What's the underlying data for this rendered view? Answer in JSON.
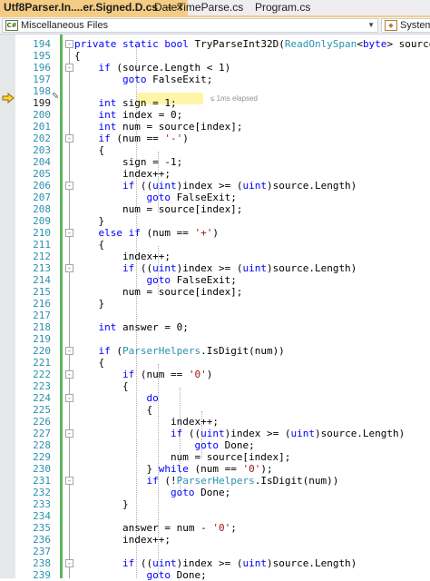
{
  "tabs": [
    {
      "label": "Utf8Parser.In....er.Signed.D.cs",
      "pin": "⊣",
      "close": "✕"
    },
    {
      "label": "DateTimeParse.cs"
    },
    {
      "label": "Program.cs"
    }
  ],
  "navbar": {
    "left": "Miscellaneous Files",
    "right": "System"
  },
  "elapsed": "≤ 1ms elapsed",
  "lines": [
    {
      "n": "194",
      "fold": "-",
      "tokens": [
        [
          "k",
          "private"
        ],
        [
          "p",
          " "
        ],
        [
          "k",
          "static"
        ],
        [
          "p",
          " "
        ],
        [
          "k",
          "bool"
        ],
        [
          "p",
          " TryParseInt32D("
        ],
        [
          "t",
          "ReadOnlySpan"
        ],
        [
          "p",
          "<"
        ],
        [
          "k",
          "byte"
        ],
        [
          "p",
          "> source, "
        ]
      ]
    },
    {
      "n": "195",
      "tokens": [
        [
          "p",
          "{"
        ]
      ]
    },
    {
      "n": "196",
      "fold": "-",
      "tokens": [
        [
          "p",
          "    "
        ],
        [
          "k",
          "if"
        ],
        [
          "p",
          " (source.Length < 1)"
        ]
      ]
    },
    {
      "n": "197",
      "tokens": [
        [
          "p",
          "        "
        ],
        [
          "k",
          "goto"
        ],
        [
          "p",
          " FalseExit;"
        ]
      ]
    },
    {
      "n": "198",
      "tokens": []
    },
    {
      "n": "199",
      "current": true,
      "tokens": [
        [
          "p",
          "    "
        ],
        [
          "k",
          "int"
        ],
        [
          "p",
          " sign = 1;"
        ]
      ]
    },
    {
      "n": "200",
      "tokens": [
        [
          "p",
          "    "
        ],
        [
          "k",
          "int"
        ],
        [
          "p",
          " index = 0;"
        ]
      ]
    },
    {
      "n": "201",
      "tokens": [
        [
          "p",
          "    "
        ],
        [
          "k",
          "int"
        ],
        [
          "p",
          " num = source[index];"
        ]
      ]
    },
    {
      "n": "202",
      "fold": "-",
      "tokens": [
        [
          "p",
          "    "
        ],
        [
          "k",
          "if"
        ],
        [
          "p",
          " (num == "
        ],
        [
          "s",
          "'-'"
        ],
        [
          "p",
          ")"
        ]
      ]
    },
    {
      "n": "203",
      "tokens": [
        [
          "p",
          "    {"
        ]
      ]
    },
    {
      "n": "204",
      "tokens": [
        [
          "p",
          "        sign = -1;"
        ]
      ]
    },
    {
      "n": "205",
      "tokens": [
        [
          "p",
          "        index++;"
        ]
      ]
    },
    {
      "n": "206",
      "fold": "-",
      "tokens": [
        [
          "p",
          "        "
        ],
        [
          "k",
          "if"
        ],
        [
          "p",
          " (("
        ],
        [
          "k",
          "uint"
        ],
        [
          "p",
          ")index >= ("
        ],
        [
          "k",
          "uint"
        ],
        [
          "p",
          ")source.Length)"
        ]
      ]
    },
    {
      "n": "207",
      "tokens": [
        [
          "p",
          "            "
        ],
        [
          "k",
          "goto"
        ],
        [
          "p",
          " FalseExit;"
        ]
      ]
    },
    {
      "n": "208",
      "tokens": [
        [
          "p",
          "        num = source[index];"
        ]
      ]
    },
    {
      "n": "209",
      "tokens": [
        [
          "p",
          "    }"
        ]
      ]
    },
    {
      "n": "210",
      "fold": "-",
      "tokens": [
        [
          "p",
          "    "
        ],
        [
          "k",
          "else"
        ],
        [
          "p",
          " "
        ],
        [
          "k",
          "if"
        ],
        [
          "p",
          " (num == "
        ],
        [
          "s",
          "'+'"
        ],
        [
          "p",
          ")"
        ]
      ]
    },
    {
      "n": "211",
      "tokens": [
        [
          "p",
          "    {"
        ]
      ]
    },
    {
      "n": "212",
      "tokens": [
        [
          "p",
          "        index++;"
        ]
      ]
    },
    {
      "n": "213",
      "fold": "-",
      "tokens": [
        [
          "p",
          "        "
        ],
        [
          "k",
          "if"
        ],
        [
          "p",
          " (("
        ],
        [
          "k",
          "uint"
        ],
        [
          "p",
          ")index >= ("
        ],
        [
          "k",
          "uint"
        ],
        [
          "p",
          ")source.Length)"
        ]
      ]
    },
    {
      "n": "214",
      "tokens": [
        [
          "p",
          "            "
        ],
        [
          "k",
          "goto"
        ],
        [
          "p",
          " FalseExit;"
        ]
      ]
    },
    {
      "n": "215",
      "tokens": [
        [
          "p",
          "        num = source[index];"
        ]
      ]
    },
    {
      "n": "216",
      "tokens": [
        [
          "p",
          "    }"
        ]
      ]
    },
    {
      "n": "217",
      "tokens": []
    },
    {
      "n": "218",
      "tokens": [
        [
          "p",
          "    "
        ],
        [
          "k",
          "int"
        ],
        [
          "p",
          " answer = 0;"
        ]
      ]
    },
    {
      "n": "219",
      "tokens": []
    },
    {
      "n": "220",
      "fold": "-",
      "tokens": [
        [
          "p",
          "    "
        ],
        [
          "k",
          "if"
        ],
        [
          "p",
          " ("
        ],
        [
          "t",
          "ParserHelpers"
        ],
        [
          "p",
          ".IsDigit(num))"
        ]
      ]
    },
    {
      "n": "221",
      "tokens": [
        [
          "p",
          "    {"
        ]
      ]
    },
    {
      "n": "222",
      "fold": "-",
      "tokens": [
        [
          "p",
          "        "
        ],
        [
          "k",
          "if"
        ],
        [
          "p",
          " (num == "
        ],
        [
          "s",
          "'0'"
        ],
        [
          "p",
          ")"
        ]
      ]
    },
    {
      "n": "223",
      "tokens": [
        [
          "p",
          "        {"
        ]
      ]
    },
    {
      "n": "224",
      "fold": "-",
      "tokens": [
        [
          "p",
          "            "
        ],
        [
          "k",
          "do"
        ]
      ]
    },
    {
      "n": "225",
      "tokens": [
        [
          "p",
          "            {"
        ]
      ]
    },
    {
      "n": "226",
      "tokens": [
        [
          "p",
          "                index++;"
        ]
      ]
    },
    {
      "n": "227",
      "fold": "-",
      "tokens": [
        [
          "p",
          "                "
        ],
        [
          "k",
          "if"
        ],
        [
          "p",
          " (("
        ],
        [
          "k",
          "uint"
        ],
        [
          "p",
          ")index >= ("
        ],
        [
          "k",
          "uint"
        ],
        [
          "p",
          ")source.Length)"
        ]
      ]
    },
    {
      "n": "228",
      "tokens": [
        [
          "p",
          "                    "
        ],
        [
          "k",
          "goto"
        ],
        [
          "p",
          " Done;"
        ]
      ]
    },
    {
      "n": "229",
      "tokens": [
        [
          "p",
          "                num = source[index];"
        ]
      ]
    },
    {
      "n": "230",
      "tokens": [
        [
          "p",
          "            } "
        ],
        [
          "k",
          "while"
        ],
        [
          "p",
          " (num == "
        ],
        [
          "s",
          "'0'"
        ],
        [
          "p",
          ");"
        ]
      ]
    },
    {
      "n": "231",
      "fold": "-",
      "tokens": [
        [
          "p",
          "            "
        ],
        [
          "k",
          "if"
        ],
        [
          "p",
          " (!"
        ],
        [
          "t",
          "ParserHelpers"
        ],
        [
          "p",
          ".IsDigit(num))"
        ]
      ]
    },
    {
      "n": "232",
      "tokens": [
        [
          "p",
          "                "
        ],
        [
          "k",
          "goto"
        ],
        [
          "p",
          " Done;"
        ]
      ]
    },
    {
      "n": "233",
      "tokens": [
        [
          "p",
          "        }"
        ]
      ]
    },
    {
      "n": "234",
      "tokens": []
    },
    {
      "n": "235",
      "tokens": [
        [
          "p",
          "        answer = num - "
        ],
        [
          "s",
          "'0'"
        ],
        [
          "p",
          ";"
        ]
      ]
    },
    {
      "n": "236",
      "tokens": [
        [
          "p",
          "        index++;"
        ]
      ]
    },
    {
      "n": "237",
      "tokens": []
    },
    {
      "n": "238",
      "fold": "-",
      "tokens": [
        [
          "p",
          "        "
        ],
        [
          "k",
          "if"
        ],
        [
          "p",
          " (("
        ],
        [
          "k",
          "uint"
        ],
        [
          "p",
          ")index >= ("
        ],
        [
          "k",
          "uint"
        ],
        [
          "p",
          ")source.Length)"
        ]
      ]
    },
    {
      "n": "239",
      "tokens": [
        [
          "p",
          "            "
        ],
        [
          "k",
          "goto"
        ],
        [
          "p",
          " Done;"
        ]
      ]
    }
  ]
}
